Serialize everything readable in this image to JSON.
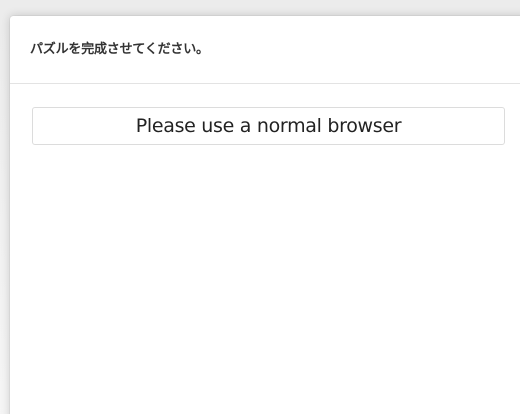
{
  "dialog": {
    "instruction": "パズルを完成させてください。",
    "notice": "Please use a normal browser"
  }
}
